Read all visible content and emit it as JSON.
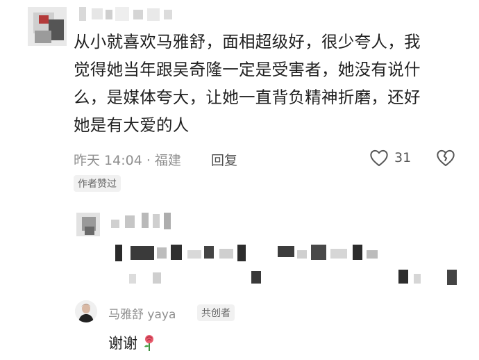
{
  "comment": {
    "lines": [
      "从小就喜欢马雅舒，面相超级好，很少夸人，我",
      "觉得她当年跟吴奇隆一定是受害者，她没有说什",
      "么，是媒体夸大，让她一直背负精神折磨，还好",
      "她是有大爱的人"
    ],
    "meta": "昨天 14:04 · 福建",
    "reply_label": "回复",
    "like_count": "31",
    "author_badge": "作者赞过"
  },
  "reply": {
    "user_name": "马雅舒 yaya",
    "role_badge": "共创者",
    "text": "谢谢"
  },
  "icons": {
    "like": "heart-outline-icon",
    "dislike": "broken-heart-icon",
    "emoji": "rose-emoji-icon"
  }
}
